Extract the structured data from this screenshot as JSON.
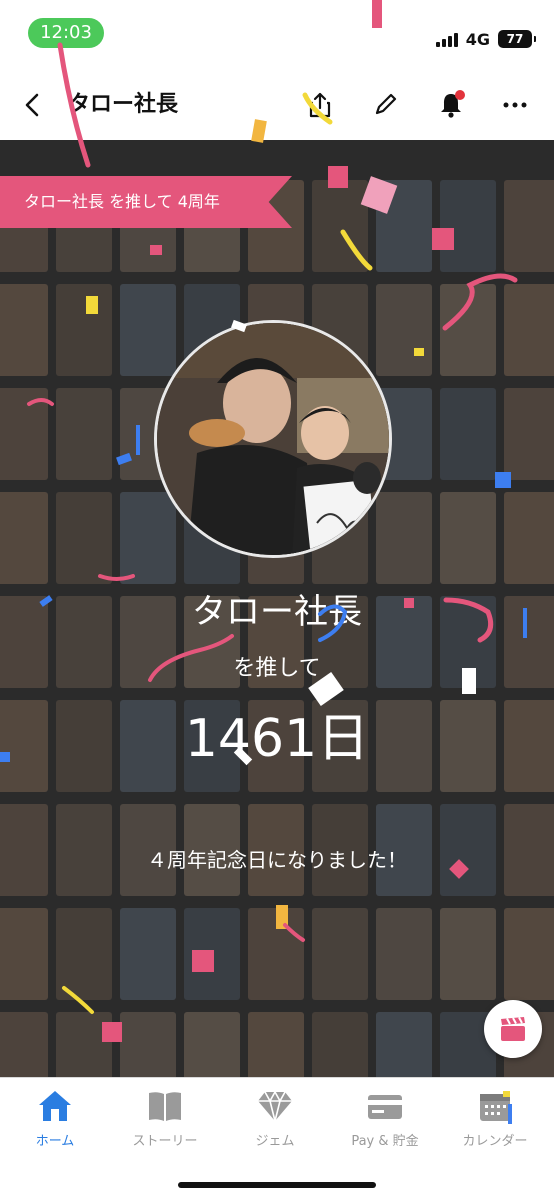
{
  "status_bar": {
    "time": "12:03",
    "network": "4G",
    "battery": "77"
  },
  "header": {
    "title": "タロー社長"
  },
  "icons": [
    "back-icon",
    "share-icon",
    "edit-pencil-icon",
    "bell-icon",
    "more-icon",
    "movie-clapper-icon",
    "home-icon",
    "story-book-icon",
    "gem-icon",
    "card-icon",
    "calendar-icon"
  ],
  "banner": {
    "text": "タロー社長 を推して 4周年"
  },
  "celebration": {
    "name": "タロー社長",
    "subtitle": "を推して",
    "days": "1461日",
    "message": "４周年記念日になりました！"
  },
  "tabs": [
    {
      "label": "ホーム",
      "active": true
    },
    {
      "label": "ストーリー",
      "active": false
    },
    {
      "label": "ジェム",
      "active": false
    },
    {
      "label": "Pay & 貯金",
      "active": false
    },
    {
      "label": "カレンダー",
      "active": false
    }
  ],
  "colors": {
    "accent_pink": "#e4567c",
    "active_tab": "#2a7de1",
    "status_green": "#4cc95a"
  }
}
